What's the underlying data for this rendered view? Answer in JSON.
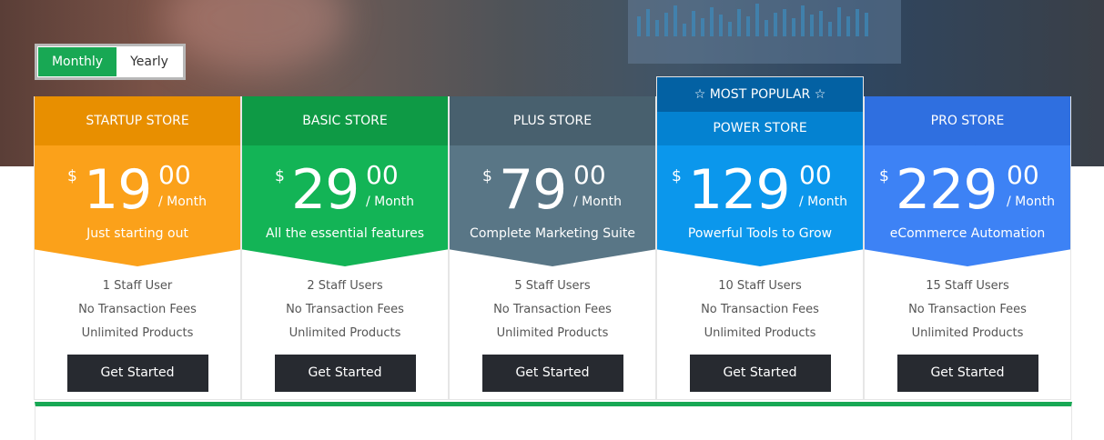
{
  "toggle": {
    "options": [
      "Monthly",
      "Yearly"
    ],
    "selected": "Monthly"
  },
  "colors": {
    "accent_green": "#18a854",
    "cta_dark": "#272a30"
  },
  "plans": [
    {
      "name": "STARTUP STORE",
      "currency": "$",
      "amount": "19",
      "cents": "00",
      "period": "/ Month",
      "tagline": "Just starting out",
      "features": [
        "1 Staff User",
        "No Transaction Fees",
        "Unlimited Products"
      ],
      "cta": "Get Started",
      "title_color": "#e88f00",
      "price_color": "#fba11a"
    },
    {
      "name": "BASIC STORE",
      "currency": "$",
      "amount": "29",
      "cents": "00",
      "period": "/ Month",
      "tagline": "All the essential features",
      "features": [
        "2 Staff Users",
        "No Transaction Fees",
        "Unlimited Products"
      ],
      "cta": "Get Started",
      "title_color": "#0e9a45",
      "price_color": "#13b456"
    },
    {
      "name": "PLUS STORE",
      "currency": "$",
      "amount": "79",
      "cents": "00",
      "period": "/ Month",
      "tagline": "Complete Marketing Suite",
      "features": [
        "5 Staff Users",
        "No Transaction Fees",
        "Unlimited Products"
      ],
      "cta": "Get Started",
      "title_color": "#48606e",
      "price_color": "#597686"
    },
    {
      "name": "POWER STORE",
      "badge": "☆ MOST POPULAR ☆",
      "currency": "$",
      "amount": "129",
      "cents": "00",
      "period": "/ Month",
      "tagline": "Powerful Tools to Grow",
      "features": [
        "10 Staff Users",
        "No Transaction Fees",
        "Unlimited Products"
      ],
      "cta": "Get Started",
      "title_color": "#0482d1",
      "price_color": "#0b97ec",
      "badge_color": "#0361a3"
    },
    {
      "name": "PRO STORE",
      "currency": "$",
      "amount": "229",
      "cents": "00",
      "period": "/ Month",
      "tagline": "eCommerce Automation",
      "features": [
        "15 Staff Users",
        "No Transaction Fees",
        "Unlimited Products"
      ],
      "cta": "Get Started",
      "title_color": "#2f6fe0",
      "price_color": "#3d82f5"
    }
  ]
}
